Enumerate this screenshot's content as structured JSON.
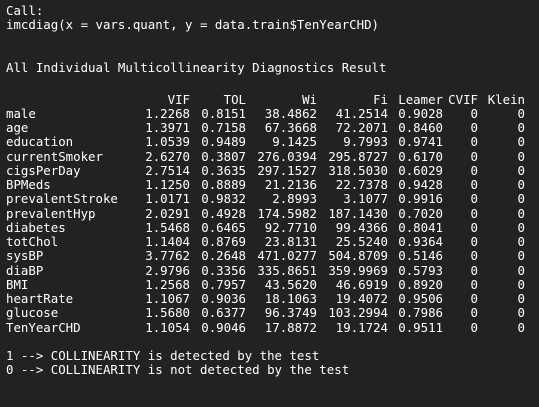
{
  "console": {
    "call_label": "Call:",
    "call_expr": "imcdiag(x = vars.quant, y = data.train$TenYearCHD)",
    "result_title": "All Individual Multicollinearity Diagnostics Result",
    "columns": [
      "",
      "VIF",
      "TOL",
      "Wi",
      "Fi",
      "Leamer",
      "CVIF",
      "Klein"
    ],
    "rows": [
      [
        "male",
        "1.2268",
        "0.8151",
        "38.4862",
        "41.2514",
        "0.9028",
        "0",
        "0"
      ],
      [
        "age",
        "1.3971",
        "0.7158",
        "67.3668",
        "72.2071",
        "0.8460",
        "0",
        "0"
      ],
      [
        "education",
        "1.0539",
        "0.9489",
        "9.1425",
        "9.7993",
        "0.9741",
        "0",
        "0"
      ],
      [
        "currentSmoker",
        "2.6270",
        "0.3807",
        "276.0394",
        "295.8727",
        "0.6170",
        "0",
        "0"
      ],
      [
        "cigsPerDay",
        "2.7514",
        "0.3635",
        "297.1527",
        "318.5030",
        "0.6029",
        "0",
        "0"
      ],
      [
        "BPMeds",
        "1.1250",
        "0.8889",
        "21.2136",
        "22.7378",
        "0.9428",
        "0",
        "0"
      ],
      [
        "prevalentStroke",
        "1.0171",
        "0.9832",
        "2.8993",
        "3.1077",
        "0.9916",
        "0",
        "0"
      ],
      [
        "prevalentHyp",
        "2.0291",
        "0.4928",
        "174.5982",
        "187.1430",
        "0.7020",
        "0",
        "0"
      ],
      [
        "diabetes",
        "1.5468",
        "0.6465",
        "92.7710",
        "99.4366",
        "0.8041",
        "0",
        "0"
      ],
      [
        "totChol",
        "1.1404",
        "0.8769",
        "23.8131",
        "25.5240",
        "0.9364",
        "0",
        "0"
      ],
      [
        "sysBP",
        "3.7762",
        "0.2648",
        "471.0277",
        "504.8709",
        "0.5146",
        "0",
        "0"
      ],
      [
        "diaBP",
        "2.9796",
        "0.3356",
        "335.8651",
        "359.9969",
        "0.5793",
        "0",
        "0"
      ],
      [
        "BMI",
        "1.2568",
        "0.7957",
        "43.5620",
        "46.6919",
        "0.8920",
        "0",
        "0"
      ],
      [
        "heartRate",
        "1.1067",
        "0.9036",
        "18.1063",
        "19.4072",
        "0.9506",
        "0",
        "0"
      ],
      [
        "glucose",
        "1.5680",
        "0.6377",
        "96.3749",
        "103.2994",
        "0.7986",
        "0",
        "0"
      ],
      [
        "TenYearCHD",
        "1.1054",
        "0.9046",
        "17.8872",
        "19.1724",
        "0.9511",
        "0",
        "0"
      ]
    ],
    "legend_detected": "1 --> COLLINEARITY is detected by the test",
    "legend_not_detected": "0 --> COLLINEARITY is not detected by the test"
  },
  "colors": {
    "background": "#222222",
    "text": "#ffffff"
  }
}
